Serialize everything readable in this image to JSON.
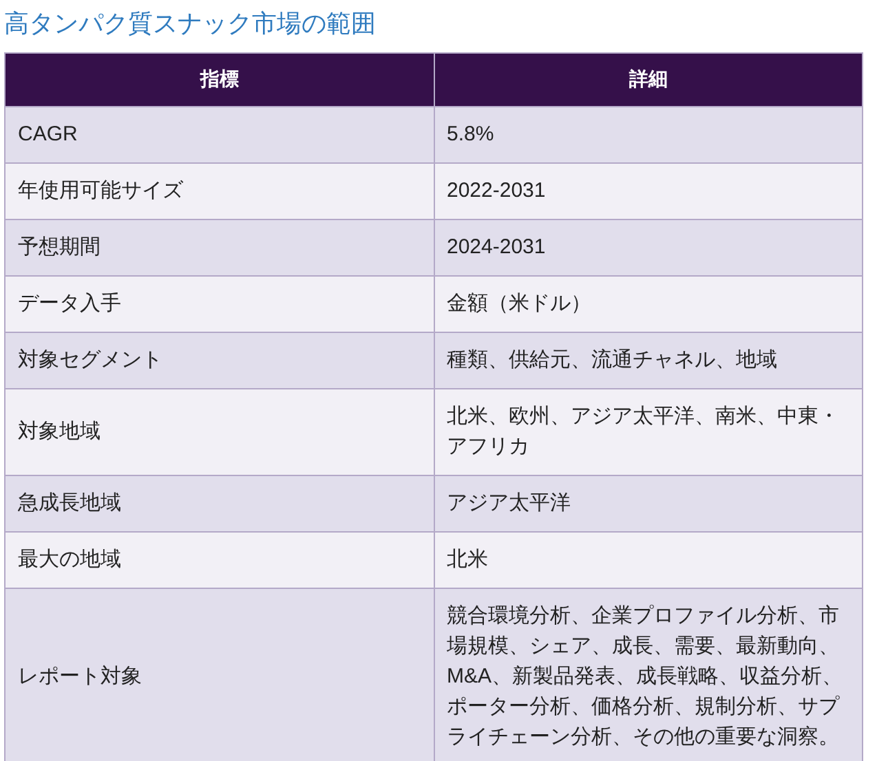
{
  "title": "高タンパク質スナック市場の範囲",
  "table": {
    "columns": [
      "指標",
      "詳細"
    ],
    "rows": [
      {
        "cells": [
          "CAGR",
          "5.8%"
        ]
      },
      {
        "cells": [
          "年使用可能サイズ",
          "2022-2031"
        ]
      },
      {
        "cells": [
          "予想期間",
          "2024-2031"
        ]
      },
      {
        "cells": [
          "データ入手",
          "金額（米ドル）"
        ]
      },
      {
        "cells": [
          "対象セグメント",
          "種類、供給元、流通チャネル、地域"
        ]
      },
      {
        "cells": [
          "対象地域",
          "北米、欧州、アジア太平洋、南米、中東・アフリカ"
        ]
      },
      {
        "cells": [
          "急成長地域",
          "アジア太平洋"
        ]
      },
      {
        "cells": [
          "最大の地域",
          "北米"
        ]
      },
      {
        "cells": [
          "レポート対象",
          "競合環境分析、企業プロファイル分析、市場規模、シェア、成長、需要、最新動向、M&A、新製品発表、成長戦略、収益分析、ポーター分析、価格分析、規制分析、サプライチェーン分析、その他の重要な洞察。"
        ]
      }
    ]
  }
}
